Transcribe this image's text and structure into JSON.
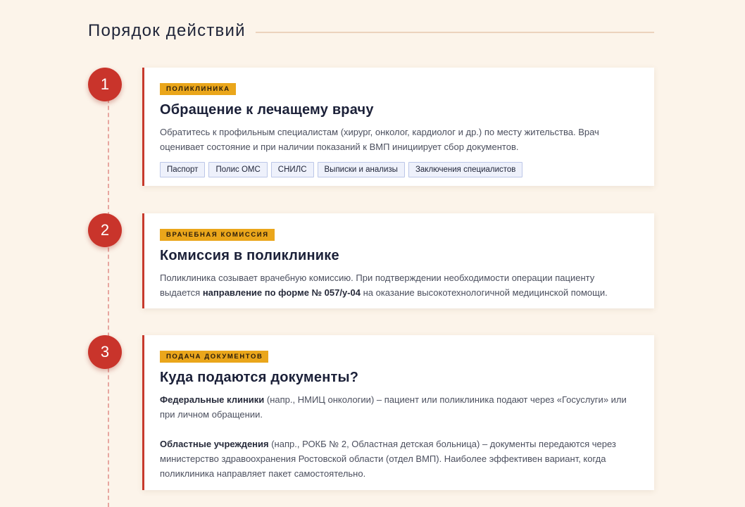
{
  "header": {
    "title": "Порядок действий"
  },
  "steps": [
    {
      "number": "1",
      "tag": "ПОЛИКЛИНИКА",
      "title": "Обращение к лечащему врачу",
      "text": "Обратитесь к профильным специалистам (хирург, онколог, кардиолог и др.) по месту жительства. Врач оценивает состояние и при наличии показаний к ВМП инициирует сбор документов.",
      "chips": [
        "Паспорт",
        "Полис ОМС",
        "СНИЛС",
        "Выписки и анализы",
        "Заключения специалистов"
      ]
    },
    {
      "number": "2",
      "tag": "ВРАЧЕБНАЯ КОМИССИЯ",
      "title": "Комиссия в поликлинике",
      "text_before": "Поликлиника созывает врачебную комиссию. При подтверждении необходимости операции пациенту выдается ",
      "text_bold": "направление по форме № 057/у-04",
      "text_after": " на оказание высокотехнологичной медицинской помощи."
    },
    {
      "number": "3",
      "tag": "ПОДАЧА ДОКУМЕНТОВ",
      "title": "Куда подаются документы?",
      "paragraphs": [
        {
          "bold": "Федеральные клиники",
          "text": " (напр., НМИЦ онкологии) – пациент или поликлиника подают через «Госуслуги» или при личном обращении."
        },
        {
          "bold": "Областные учреждения",
          "text": " (напр., РОКБ № 2, Областная детская больница) – документы передаются через министерство здравоохранения Ростовской области (отдел ВМП). Наиболее эффективен вариант, когда поликлиника направляет пакет самостоятельно."
        }
      ]
    }
  ],
  "colors": {
    "background": "#fcf4ea",
    "accent_red": "#c9342b",
    "tag_yellow": "#eaa61b",
    "chip_bg": "#eef1fb",
    "chip_border": "#bcc7e8"
  }
}
